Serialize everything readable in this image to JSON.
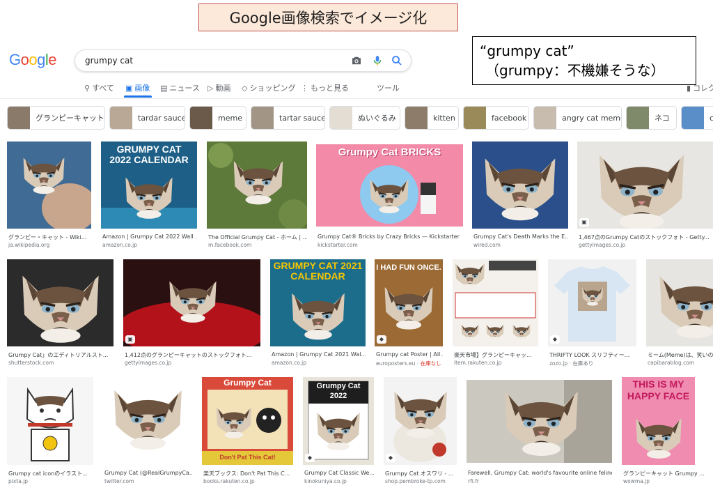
{
  "annotation": {
    "title": "Google画像検索でイメージ化",
    "note_line1": "“grumpy cat”",
    "note_line2": "（grumpy：不機嫌そうな）"
  },
  "logo": "Google",
  "search": {
    "query": "grumpy cat"
  },
  "tabs": [
    {
      "label": "すべて",
      "icon": "search-icon"
    },
    {
      "label": "画像",
      "icon": "image-icon",
      "active": true
    },
    {
      "label": "ニュース",
      "icon": "news-icon"
    },
    {
      "label": "動画",
      "icon": "video-icon"
    },
    {
      "label": "ショッピング",
      "icon": "tag-icon"
    },
    {
      "label": "もっと見る",
      "icon": "more-vert-icon"
    },
    {
      "label": "ツール"
    }
  ],
  "collection_label": "コレク",
  "chips": [
    "グランピーキャット",
    "tardar sauce",
    "meme",
    "tartar sauce",
    "ぬいぐるみ",
    "kitten",
    "facebook",
    "angry cat meme",
    "ネコ",
    "c"
  ],
  "results": [
    {
      "caption": "グランピー・キャット - Wiki...",
      "source": "ja.wikipedia.org"
    },
    {
      "caption": "Amazon | Grumpy Cat 2022 Wall ...",
      "source": "amazon.co.jp",
      "overlay": "GRUMPY CAT 2022 CALENDAR"
    },
    {
      "caption": "The Official Grumpy Cat - ホーム | ...",
      "source": "m.facebook.com"
    },
    {
      "caption": "Grumpy Cat® Bricks by Crazy Bricks — Kickstarter",
      "source": "kickstarter.com",
      "overlay": "Grumpy Cat BRICKS"
    },
    {
      "caption": "Grumpy Cat's Death Marks the E...",
      "source": "wired.com"
    },
    {
      "caption": "1,467点のGrumpy Catのストックフォト - Getty...",
      "source": "gettyimages.co.jp"
    },
    {
      "caption": "Grumpy Cat」のエディトリアルスト...",
      "source": "shutterstock.com"
    },
    {
      "caption": "1,412点のグランピーキャットのストックフォト...",
      "source": "gettyimages.co.jp"
    },
    {
      "caption": "Amazon | Grumpy Cat 2021 Wal...",
      "source": "amazon.co.jp",
      "overlay": "GRUMPY CAT 2021 CALENDAR"
    },
    {
      "caption": "Grumpy cat Poster | All...",
      "source": "europosters.eu",
      "stock": "在庫なし",
      "overlay": "I HAD FUN ONCE."
    },
    {
      "caption": "楽天市場】グランピーキャッ...",
      "source": "item.rakuten.co.jp"
    },
    {
      "caption": "THRIFTY LOOK スリフティー...",
      "source": "zozo.jp",
      "stock": "在庫あり"
    },
    {
      "caption": "ミーム(Meme)は、笑いの...",
      "source": "capibarablog.com"
    },
    {
      "caption": "Grumpy cat iconのイラスト...",
      "source": "pixta.jp"
    },
    {
      "caption": "Grumpy Cat (@RealGrumpyCa...",
      "source": "twitter.com"
    },
    {
      "caption": "楽天ブックス: Don't Pat This C...",
      "source": "books.rakuten.co.jp",
      "overlay": "Grumpy Cat",
      "overlay2": "Don't Pat This Cat!"
    },
    {
      "caption": "Grumpy Cat Classic We...",
      "source": "kinokuniya.co.jp",
      "overlay": "Grumpy Cat 2022"
    },
    {
      "caption": "Grumpy Cat オスワリ - ...",
      "source": "shop.pembroke-tp.com"
    },
    {
      "caption": "Farewell, Grumpy Cat: world's favourite online feline...",
      "source": "rfi.fr"
    },
    {
      "caption": "グランピーキャット Grumpy ...",
      "source": "wowma.jp",
      "overlay": "THIS IS MY HAPPY FACE"
    }
  ]
}
